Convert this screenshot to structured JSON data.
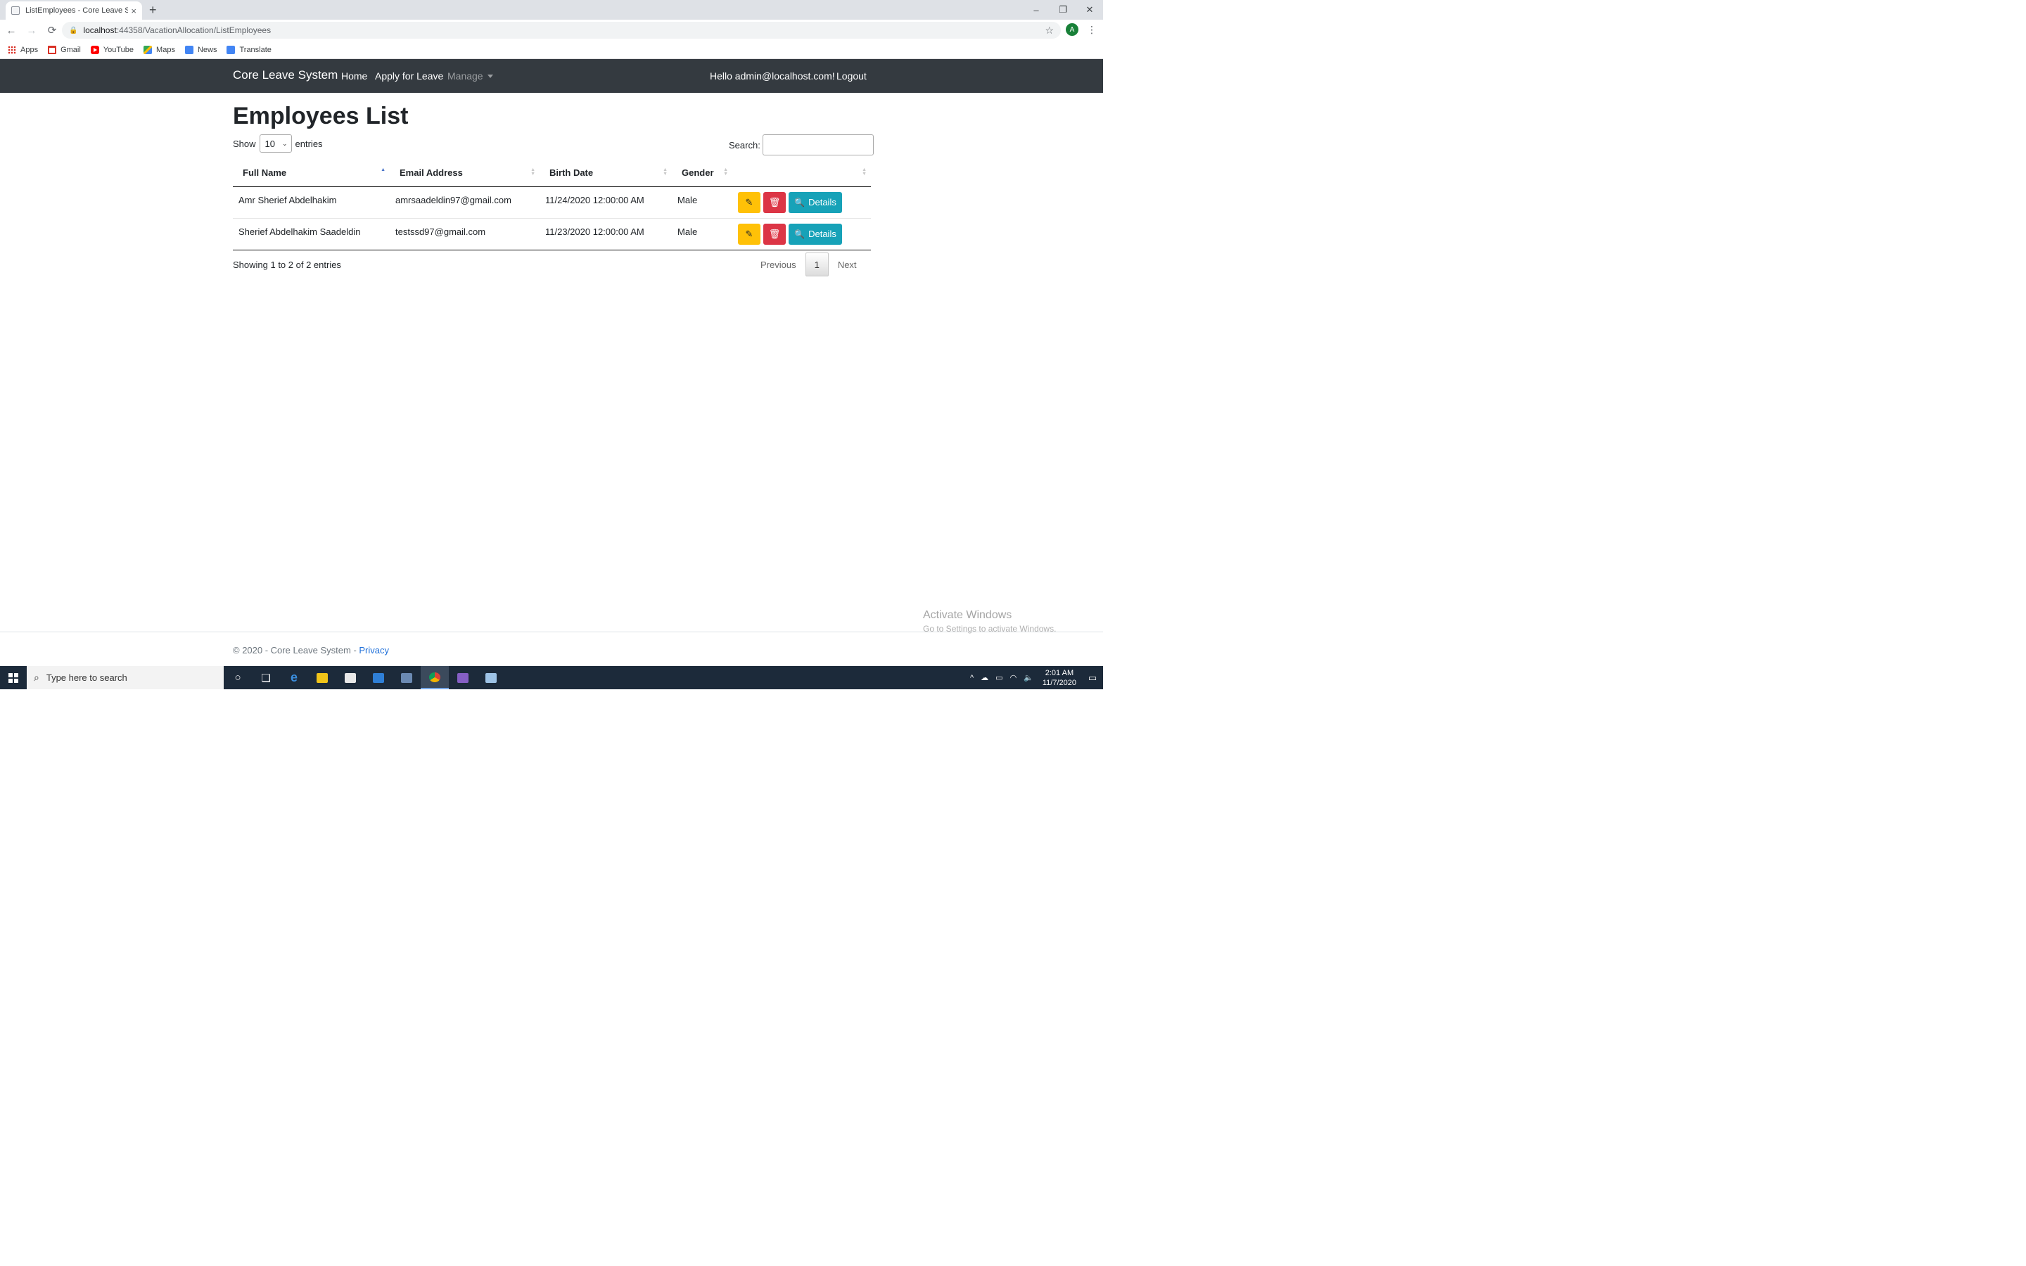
{
  "browser": {
    "tab_title": "ListEmployees - Core Leave System",
    "new_tab_glyph": "+",
    "close_glyph": "×",
    "win_minimize": "–",
    "win_restore": "❐",
    "win_close": "✕",
    "back_glyph": "←",
    "forward_glyph": "→",
    "reload_glyph": "⟳",
    "url_host": "localhost",
    "url_path": ":44358/VacationAllocation/ListEmployees",
    "lock_glyph": "🔒",
    "star_glyph": "☆",
    "profile_initial": "A",
    "menu_glyph": "⋮"
  },
  "bookmarks": [
    {
      "label": "Apps",
      "icon": "apps-icon"
    },
    {
      "label": "Gmail",
      "icon": "gmail-icon"
    },
    {
      "label": "YouTube",
      "icon": "youtube-icon"
    },
    {
      "label": "Maps",
      "icon": "maps-icon"
    },
    {
      "label": "News",
      "icon": "news-icon"
    },
    {
      "label": "Translate",
      "icon": "translate-icon"
    }
  ],
  "navbar": {
    "brand": "Core Leave System",
    "home": "Home",
    "apply": "Apply for Leave",
    "manage": "Manage",
    "greeting": "Hello admin@localhost.com!",
    "logout": "Logout"
  },
  "main": {
    "title": "Employees List",
    "show_label": "Show",
    "entries_value": "10",
    "entries_label": "entries",
    "search_label": "Search:",
    "search_value": "",
    "columns": [
      "Full Name",
      "Email Address",
      "Birth Date",
      "Gender",
      ""
    ],
    "rows": [
      {
        "name": "Amr Sherief Abdelhakim",
        "email": "amrsaadeldin97@gmail.com",
        "birth": "11/24/2020 12:00:00 AM",
        "gender": "Male"
      },
      {
        "name": "Sherief Abdelhakim Saadeldin",
        "email": "testssd97@gmail.com",
        "birth": "11/23/2020 12:00:00 AM",
        "gender": "Male"
      }
    ],
    "details_label": "Details",
    "edit_glyph": "✎",
    "delete_glyph": "🗑",
    "search_glyph": "🔍",
    "info": "Showing 1 to 2 of 2 entries",
    "prev": "Previous",
    "page": "1",
    "next": "Next"
  },
  "watermark": {
    "line1": "Activate Windows",
    "line2": "Go to Settings to activate Windows."
  },
  "footer": {
    "text": "© 2020 - Core Leave System - ",
    "privacy": "Privacy"
  },
  "taskbar": {
    "search_placeholder": "Type here to search",
    "search_glyph": "⌕",
    "cortana_glyph": "○",
    "taskview_glyph": "❏",
    "edge_glyph": "e",
    "time": "2:01 AM",
    "date": "11/7/2020",
    "tray_up": "^",
    "notif_glyph": "▭"
  },
  "colors": {
    "navbar": "#343a40",
    "edit": "#ffc107",
    "delete": "#dc3545",
    "details": "#17a2b8",
    "link": "#1e6fd9"
  }
}
